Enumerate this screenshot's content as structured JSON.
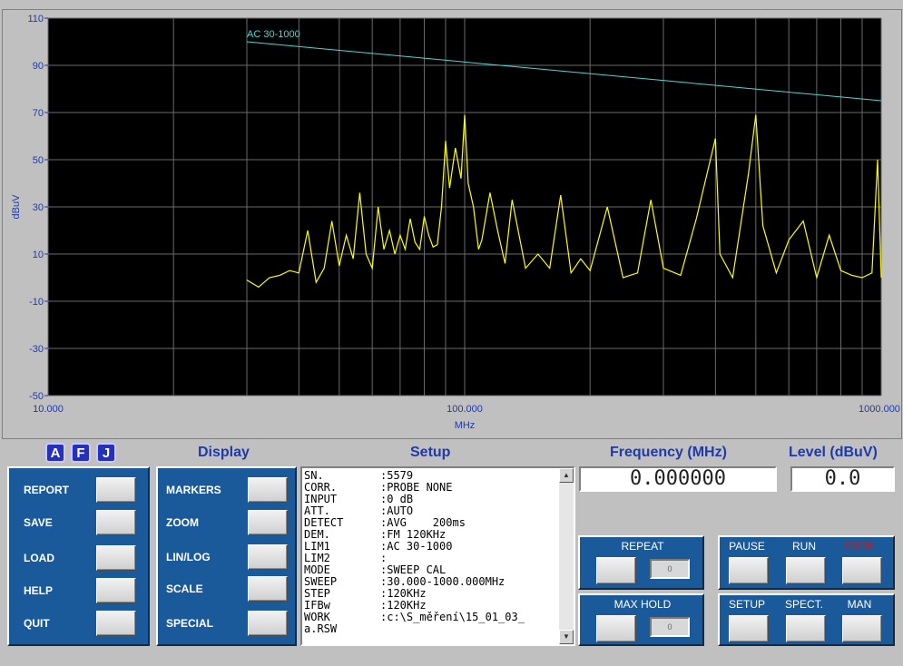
{
  "chart_data": {
    "type": "line",
    "xscale": "log",
    "xlabel": "MHz",
    "ylabel": "dBuV",
    "xlim": [
      10,
      1000
    ],
    "ylim": [
      -50,
      110
    ],
    "xticks": [
      "10.000",
      "100.000",
      "1000.000"
    ],
    "yticks": [
      "110",
      "90",
      "70",
      "50",
      "30",
      "10",
      "-10",
      "-30",
      "-50"
    ],
    "grid": true,
    "series": [
      {
        "name": "AC 30-1000",
        "color": "#4fd6d6",
        "x": [
          30,
          1000
        ],
        "y": [
          100,
          75
        ]
      },
      {
        "color": "#ffff00",
        "x": [
          30,
          32,
          34,
          36,
          38,
          40,
          42,
          44,
          46,
          48,
          50,
          52,
          54,
          56,
          58,
          60,
          62,
          64,
          66,
          68,
          70,
          72,
          74,
          76,
          78,
          80,
          82,
          84,
          86,
          88,
          90,
          92,
          95,
          98,
          100,
          102,
          105,
          108,
          110,
          115,
          120,
          125,
          130,
          140,
          150,
          160,
          170,
          180,
          190,
          200,
          220,
          240,
          260,
          280,
          300,
          330,
          360,
          400,
          410,
          440,
          480,
          500,
          520,
          560,
          600,
          650,
          700,
          750,
          800,
          850,
          900,
          950,
          980,
          1000
        ],
        "y": [
          -1,
          -4,
          0,
          1,
          3,
          2,
          20,
          -2,
          4,
          24,
          5,
          18,
          8,
          36,
          10,
          4,
          30,
          12,
          20,
          10,
          18,
          12,
          25,
          15,
          12,
          26,
          18,
          13,
          14,
          30,
          58,
          38,
          55,
          42,
          69,
          40,
          30,
          12,
          16,
          36,
          20,
          6,
          33,
          4,
          10,
          4,
          35,
          2,
          8,
          3,
          30,
          0,
          2,
          33,
          4,
          1,
          25,
          59,
          10,
          0,
          44,
          69,
          22,
          2,
          16,
          24,
          0,
          18,
          3,
          1,
          0,
          2,
          50,
          0
        ]
      }
    ]
  },
  "afj_buttons": [
    "A",
    "F",
    "J"
  ],
  "display_title": "Display",
  "setup_title": "Setup",
  "frequency_title": "Frequency (MHz)",
  "level_title": "Level (dBuV)",
  "frequency_value": "0.000000",
  "level_value": "0.0",
  "left_menu": [
    "REPORT",
    "SAVE",
    "LOAD",
    "HELP",
    "QUIT"
  ],
  "display_menu": [
    "MARKERS",
    "ZOOM",
    "LIN/LOG",
    "SCALE",
    "SPECIAL"
  ],
  "setup_lines": [
    {
      "key": "SN.",
      "value": ":5579"
    },
    {
      "key": "CORR.",
      "value": ":PROBE NONE"
    },
    {
      "key": "INPUT",
      "value": ":0 dB"
    },
    {
      "key": "ATT.",
      "value": ":AUTO"
    },
    {
      "key": "DETECT",
      "value": ":AVG    200ms"
    },
    {
      "key": "DEM.",
      "value": ":FM 120KHz"
    },
    {
      "key": "LIM1",
      "value": ":AC 30-1000"
    },
    {
      "key": "LIM2",
      "value": ":"
    },
    {
      "key": "MODE",
      "value": ":SWEEP CAL"
    },
    {
      "key": "SWEEP",
      "value": ":30.000-1000.000MHz"
    },
    {
      "key": "STEP",
      "value": ":120KHz"
    },
    {
      "key": "IFBw",
      "value": ":120KHz"
    },
    {
      "key": "WORK",
      "value": ":c:\\S_měření\\15_01_03_"
    },
    {
      "key": "a.RSW",
      "value": ""
    }
  ],
  "repeat_label": "REPEAT",
  "maxhold_label": "MAX HOLD",
  "repeat_indicator": "0",
  "maxhold_indicator": "0",
  "run_controls": [
    {
      "label": "PAUSE",
      "color": "#ffffff"
    },
    {
      "label": "RUN",
      "color": "#ffffff"
    },
    {
      "label": "STOP",
      "color": "#d01818"
    }
  ],
  "mode_controls": [
    "SETUP",
    "SPECT.",
    "MAN"
  ]
}
